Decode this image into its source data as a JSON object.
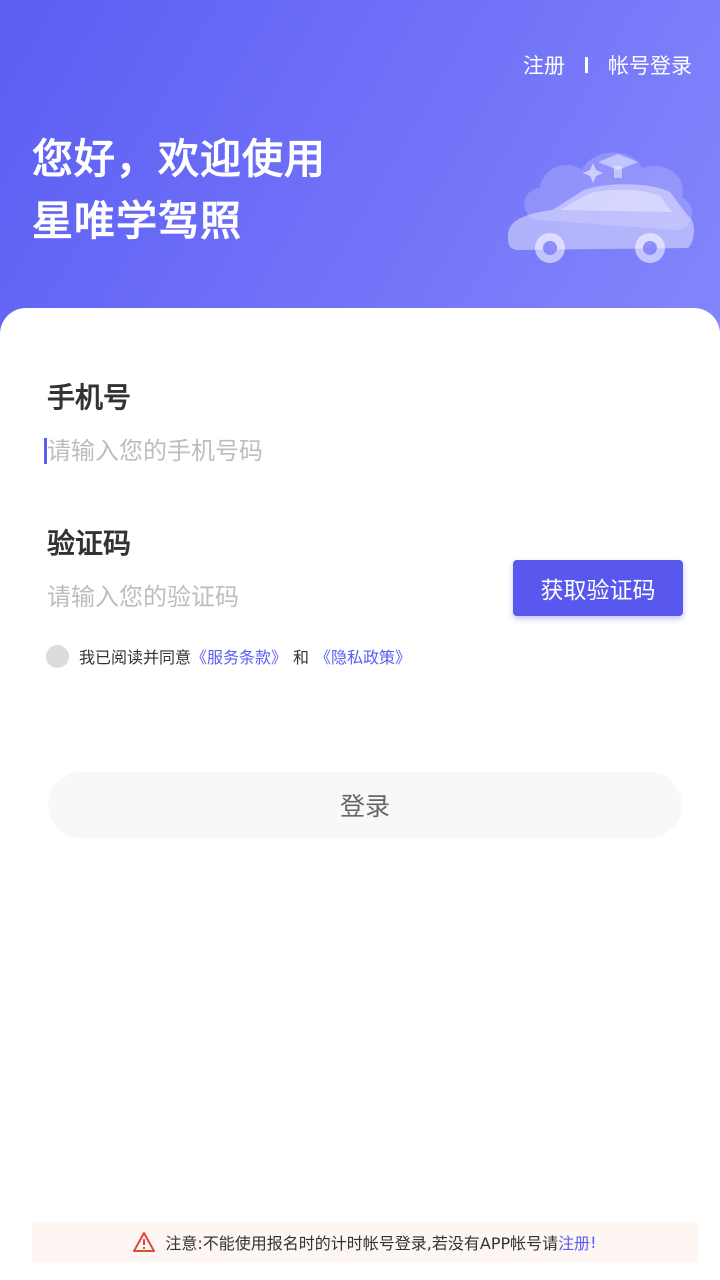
{
  "header": {
    "register_label": "注册",
    "account_login_label": "帐号登录",
    "welcome_line1": "您好，欢迎使用",
    "welcome_line2": "星唯学驾照"
  },
  "form": {
    "phone_label": "手机号",
    "phone_placeholder": "请输入您的手机号码",
    "code_label": "验证码",
    "code_placeholder": "请输入您的验证码",
    "get_code_button": "获取验证码"
  },
  "agreement": {
    "prefix": "我已阅读并同意",
    "terms_link": "《服务条款》",
    "and": "和",
    "privacy_link": "《隐私政策》"
  },
  "login_button": "登录",
  "notice": {
    "text": "注意:不能使用报名时的计时帐号登录,若没有APP帐号请",
    "register_link": "注册",
    "suffix": "!"
  },
  "colors": {
    "brand": "#5b5ef2",
    "header_gradient_end": "#8486fb",
    "notice_bg": "#fdf6f3",
    "warning": "#e04a3a"
  }
}
